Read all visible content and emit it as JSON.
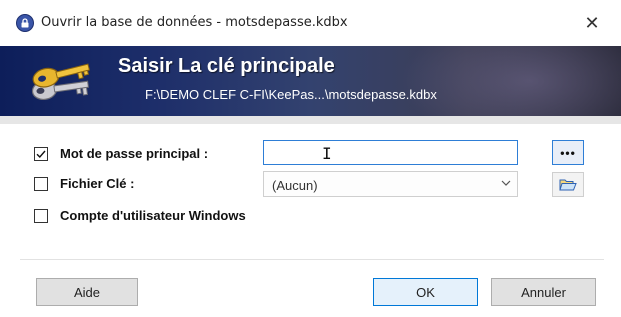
{
  "window": {
    "title": "Ouvrir la base de données - motsdepasse.kdbx",
    "close_glyph": "✕",
    "title_icon": "lock-icon"
  },
  "banner": {
    "title": "Saisir La clé principale",
    "path": "F:\\DEMO CLEF C-FI\\KeePas...\\motsdepasse.kdbx",
    "icon": "keys-icon"
  },
  "form": {
    "master_password": {
      "label": "Mot de passe principal :",
      "checked": true,
      "value": ""
    },
    "key_file": {
      "label": "Fichier Clé :",
      "checked": false,
      "selected": "(Aucun)"
    },
    "windows_account": {
      "label": "Compte d'utilisateur Windows",
      "checked": false
    },
    "show_password_glyph": "•••",
    "browse_icon": "folder-open-icon"
  },
  "buttons": {
    "help": "Aide",
    "ok": "OK",
    "cancel": "Annuler"
  },
  "colors": {
    "accent": "#0078d7",
    "banner_dark": "#0d1e5a"
  }
}
